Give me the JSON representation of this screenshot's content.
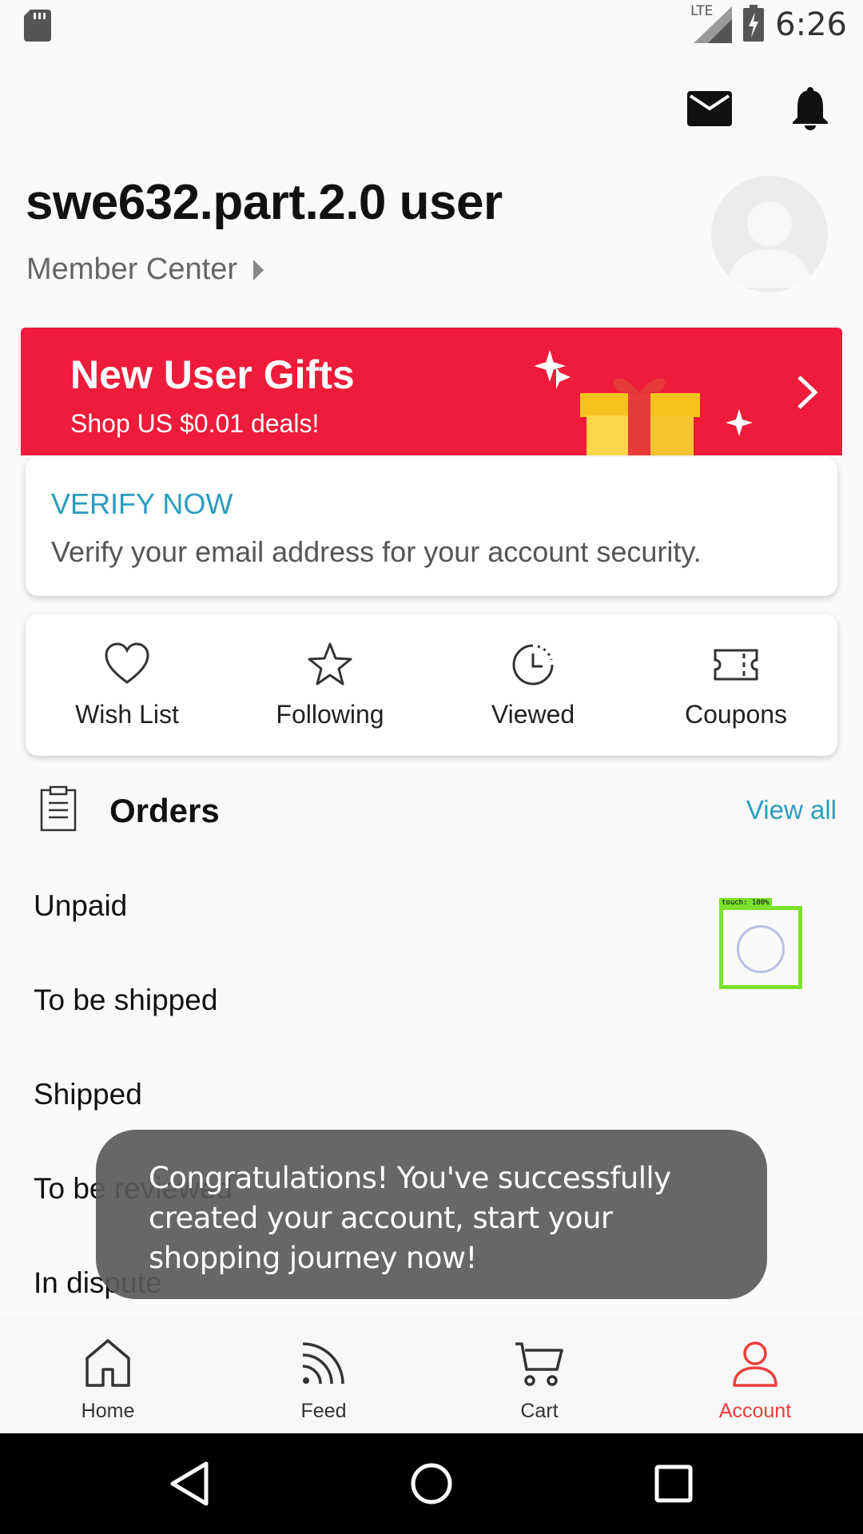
{
  "status_bar": {
    "time": "6:26",
    "network": "LTE",
    "icons": [
      "sd-card-icon",
      "signal-icon",
      "battery-charging-icon"
    ]
  },
  "header": {
    "icons": [
      "mail-icon",
      "bell-icon"
    ]
  },
  "profile": {
    "username": "swe632.part.2.0 user",
    "member_center": "Member Center"
  },
  "banner": {
    "title": "New User Gifts",
    "subtitle": "Shop US $0.01 deals!",
    "background_color": "#ee1c3a"
  },
  "verify": {
    "title": "VERIFY NOW",
    "description": "Verify your email address for your account security."
  },
  "quick_links": [
    {
      "label": "Wish List",
      "icon": "heart-icon"
    },
    {
      "label": "Following",
      "icon": "star-icon"
    },
    {
      "label": "Viewed",
      "icon": "clock-icon"
    },
    {
      "label": "Coupons",
      "icon": "coupon-icon"
    }
  ],
  "orders": {
    "title": "Orders",
    "view_all": "View all",
    "rows": [
      "Unpaid",
      "To be shipped",
      "Shipped",
      "To be reviewed",
      "In dispute"
    ]
  },
  "touch_indicator": {
    "label": "touch: 100%"
  },
  "toast": {
    "message": "Congratulations! You've successfully created your account, start your shopping journey now!"
  },
  "bottom_nav": {
    "items": [
      {
        "label": "Home",
        "icon": "home-icon"
      },
      {
        "label": "Feed",
        "icon": "feed-icon"
      },
      {
        "label": "Cart",
        "icon": "cart-icon"
      },
      {
        "label": "Account",
        "icon": "account-icon"
      }
    ],
    "active": "Account",
    "active_color": "#ee3d3d"
  },
  "accent_color": "#2a9dbf"
}
